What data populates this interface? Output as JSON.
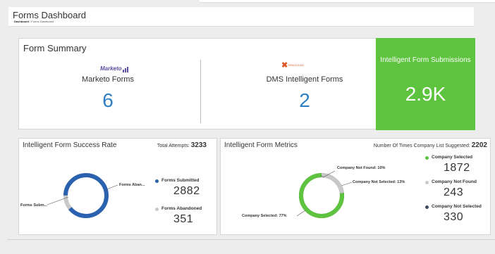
{
  "header": {
    "title": "Forms Dashboard",
    "breadcrumb_home": "Dashboard",
    "breadcrumb_sep": "/",
    "breadcrumb_current": "Forms Dashboard"
  },
  "summary": {
    "title": "Form Summary",
    "marketo": {
      "logo_text": "Marketo",
      "label": "Marketo Forms",
      "value": "6"
    },
    "dms": {
      "logo_text": "RINGLEAD",
      "label": "DMS Intelligent Forms",
      "value": "2"
    },
    "submissions": {
      "label": "Intelligent Form Submissions",
      "value": "2.9K",
      "color": "#5ec33e"
    }
  },
  "success_rate": {
    "title": "Intelligent Form Success Rate",
    "total_label": "Total Attempts:",
    "total_value": "3233",
    "donut_label_submitted": "Forms Subm...",
    "donut_label_abandoned": "Forms Aban...",
    "legend": [
      {
        "name": "Forms Submitted",
        "value": "2882",
        "color": "#2a62b0"
      },
      {
        "name": "Forms Abandoned",
        "value": "351",
        "color": "#c8c8c8"
      }
    ]
  },
  "metrics": {
    "title": "Intelligent Form Metrics",
    "total_label": "Number Of Times Company List Suggested:",
    "total_value": "2202",
    "donut_labels": {
      "not_found": "Company Not Found: 10%",
      "not_selected": "Company Not Selected: 13%",
      "selected": "Company Selected: 77%"
    },
    "legend": [
      {
        "name": "Company Selected",
        "value": "1872",
        "color": "#5ec33e"
      },
      {
        "name": "Company Not Found",
        "value": "243",
        "color": "#c8c8c8"
      },
      {
        "name": "Company Not Selected",
        "value": "330",
        "color": "#3d4a5c"
      }
    ]
  }
}
